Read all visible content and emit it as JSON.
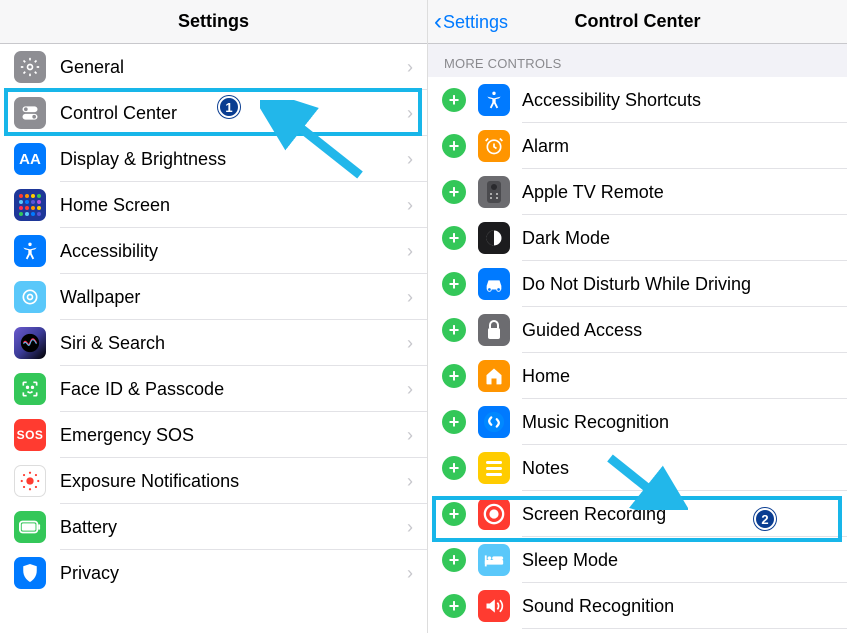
{
  "left": {
    "title": "Settings",
    "items": [
      {
        "label": "General",
        "icon": "gear-icon",
        "bg": "bg-gray"
      },
      {
        "label": "Control Center",
        "icon": "toggles-icon",
        "bg": "bg-gray"
      },
      {
        "label": "Display & Brightness",
        "icon": "display-icon",
        "bg": "bg-blue"
      },
      {
        "label": "Home Screen",
        "icon": "home-grid-icon",
        "bg": "bg-darkblue"
      },
      {
        "label": "Accessibility",
        "icon": "accessibility-icon",
        "bg": "bg-blue"
      },
      {
        "label": "Wallpaper",
        "icon": "wallpaper-icon",
        "bg": "bg-teal"
      },
      {
        "label": "Siri & Search",
        "icon": "siri-icon",
        "bg": "bg-purple"
      },
      {
        "label": "Face ID & Passcode",
        "icon": "faceid-icon",
        "bg": "bg-green"
      },
      {
        "label": "Emergency SOS",
        "icon": "sos-icon",
        "bg": "bg-red"
      },
      {
        "label": "Exposure Notifications",
        "icon": "exposure-icon",
        "bg": "bg-white"
      },
      {
        "label": "Battery",
        "icon": "battery-icon",
        "bg": "bg-green"
      },
      {
        "label": "Privacy",
        "icon": "privacy-icon",
        "bg": "bg-blue"
      }
    ]
  },
  "right": {
    "title": "Control Center",
    "back": "Settings",
    "section": "MORE CONTROLS",
    "items": [
      {
        "label": "Accessibility Shortcuts",
        "icon": "accessibility-icon",
        "bg": "bg-blue"
      },
      {
        "label": "Alarm",
        "icon": "alarm-icon",
        "bg": "bg-orange"
      },
      {
        "label": "Apple TV Remote",
        "icon": "remote-icon",
        "bg": "bg-sysgray"
      },
      {
        "label": "Dark Mode",
        "icon": "darkmode-icon",
        "bg": "bg-black"
      },
      {
        "label": "Do Not Disturb While Driving",
        "icon": "car-icon",
        "bg": "bg-blue"
      },
      {
        "label": "Guided Access",
        "icon": "lock-icon",
        "bg": "bg-sysgray"
      },
      {
        "label": "Home",
        "icon": "home-icon",
        "bg": "bg-orange"
      },
      {
        "label": "Music Recognition",
        "icon": "shazam-icon",
        "bg": "bg-blue"
      },
      {
        "label": "Notes",
        "icon": "notes-icon",
        "bg": "bg-yellow"
      },
      {
        "label": "Screen Recording",
        "icon": "record-icon",
        "bg": "bg-red"
      },
      {
        "label": "Sleep Mode",
        "icon": "bed-icon",
        "bg": "bg-teal"
      },
      {
        "label": "Sound Recognition",
        "icon": "sound-icon",
        "bg": "bg-red"
      }
    ]
  },
  "annotations": {
    "callout1": "1",
    "callout2": "2"
  }
}
